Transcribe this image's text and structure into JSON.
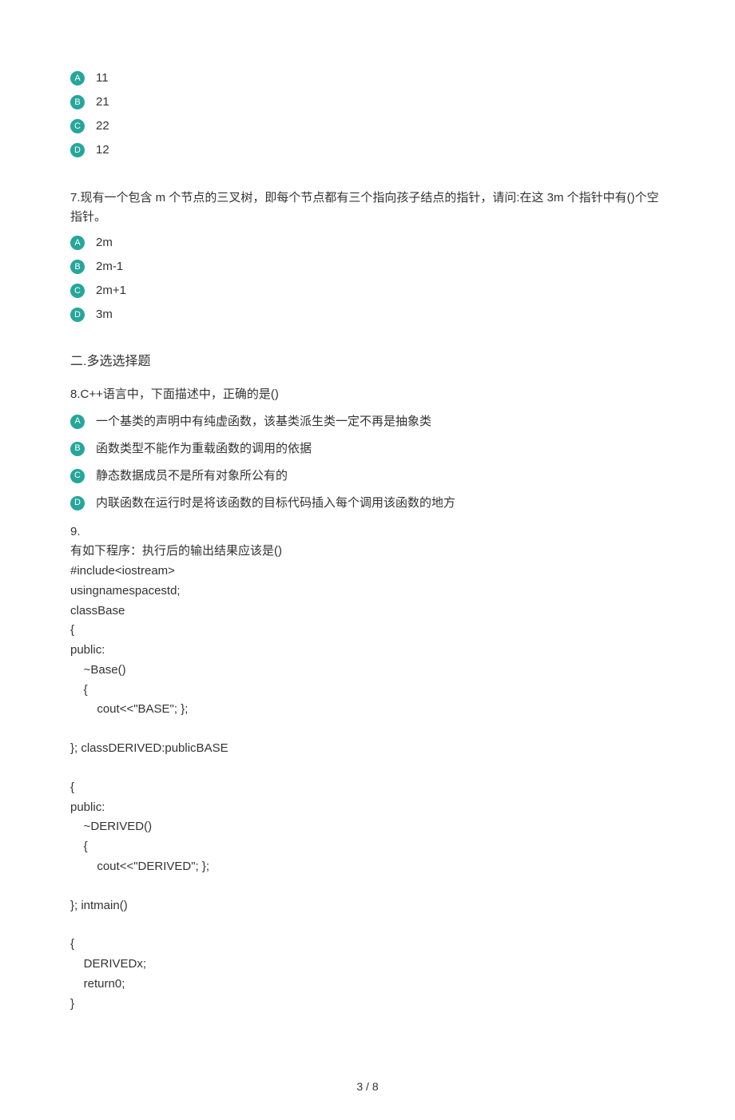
{
  "q6_continuation": {
    "options": [
      {
        "letter": "A",
        "text": "11"
      },
      {
        "letter": "B",
        "text": "21"
      },
      {
        "letter": "C",
        "text": "22"
      },
      {
        "letter": "D",
        "text": "12"
      }
    ]
  },
  "q7": {
    "prompt": "7.现有一个包含 m 个节点的三叉树，即每个节点都有三个指向孩子结点的指针，请问:在这 3m 个指针中有()个空指针。",
    "options": [
      {
        "letter": "A",
        "text": "2m"
      },
      {
        "letter": "B",
        "text": "2m-1"
      },
      {
        "letter": "C",
        "text": "2m+1"
      },
      {
        "letter": "D",
        "text": "3m"
      }
    ]
  },
  "section2_header": "二.多选选择题",
  "q8": {
    "prompt": "8.C++语言中，下面描述中，正确的是()",
    "options": [
      {
        "letter": "A",
        "text": "一个基类的声明中有纯虚函数，该基类派生类一定不再是抽象类"
      },
      {
        "letter": "B",
        "text": "函数类型不能作为重载函数的调用的依据"
      },
      {
        "letter": "C",
        "text": "静态数据成员不是所有对象所公有的"
      },
      {
        "letter": "D",
        "text": "内联函数在运行时是将该函数的目标代码插入每个调用该函数的地方"
      }
    ]
  },
  "q9": {
    "lines": [
      "9.",
      "有如下程序：执行后的输出结果应该是()",
      "#include<iostream>",
      "usingnamespacestd;",
      "classBase",
      "{",
      "public:",
      "    ~Base()",
      "    {",
      "        cout<<\"BASE\"; };",
      "",
      "}; classDERIVED:publicBASE",
      "",
      "{",
      "public:",
      "    ~DERIVED()",
      "    {",
      "        cout<<\"DERIVED\"; };",
      "",
      "}; intmain()",
      "",
      "{",
      "    DERIVEDx;",
      "    return0;",
      "}"
    ]
  },
  "page_number": "3 / 8"
}
